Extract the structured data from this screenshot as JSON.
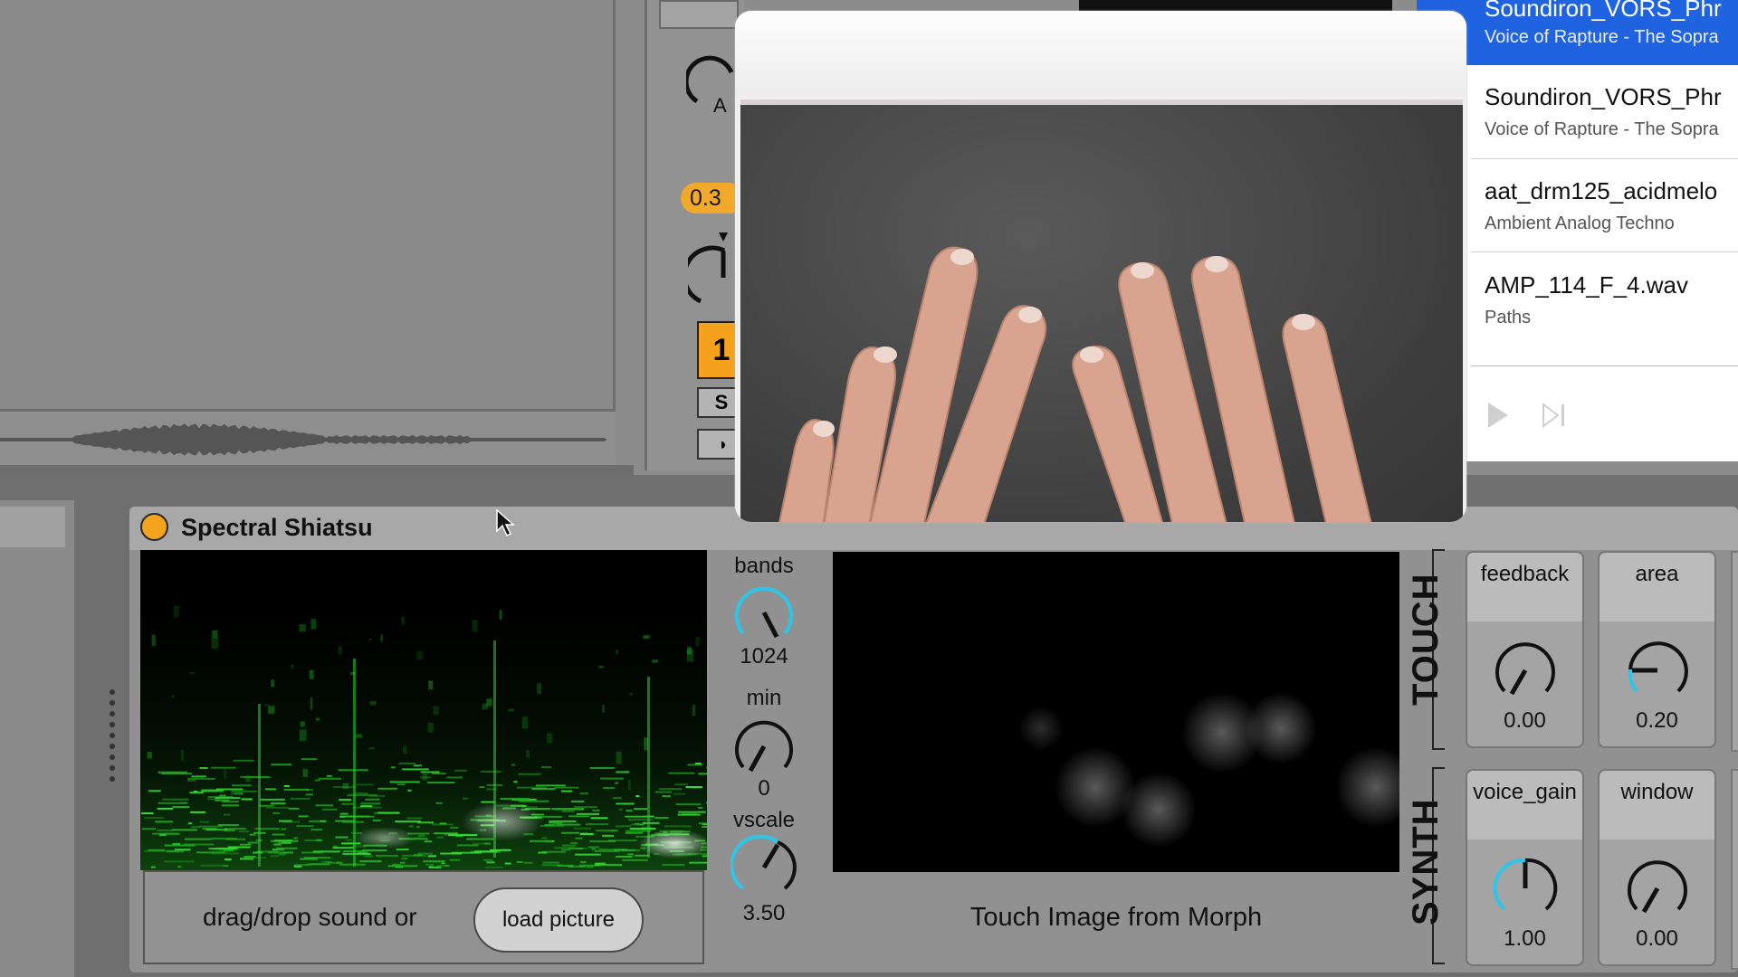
{
  "mixer": {
    "volume_value": "0.3",
    "track_number": "1",
    "solo_label": "S"
  },
  "device": {
    "title": "Spectral Shiatsu",
    "drop_text": "drag/drop sound or",
    "load_button": "load picture",
    "touch_caption": "Touch Image from Morph",
    "params": {
      "bands": {
        "label": "bands",
        "value": "1024"
      },
      "min": {
        "label": "min",
        "value": "0"
      },
      "vscale": {
        "label": "vscale",
        "value": "3.50"
      }
    },
    "sections": {
      "touch": "TOUCH",
      "synth": "SYNTH"
    },
    "macros": {
      "feedback": {
        "label": "feedback",
        "value": "0.00"
      },
      "area": {
        "label": "area",
        "value": "0.20"
      },
      "voice_gain": {
        "label": "voice_gain",
        "value": "1.00"
      },
      "window": {
        "label": "window",
        "value": "0.00"
      }
    }
  },
  "browser_list": [
    {
      "title": "Soundiron_VORS_Phr",
      "subtitle": "Voice of Rapture - The Sopra"
    },
    {
      "title": "Soundiron_VORS_Phr",
      "subtitle": "Voice of Rapture - The Sopra"
    },
    {
      "title": "aat_drm125_acidmelo",
      "subtitle": "Ambient Analog Techno"
    },
    {
      "title": "AMP_114_F_4.wav",
      "subtitle": "Paths"
    }
  ],
  "colors": {
    "accent_orange": "#f3a31c",
    "knob_cyan": "#2ec6e8",
    "selection_blue": "#1f63e0"
  }
}
